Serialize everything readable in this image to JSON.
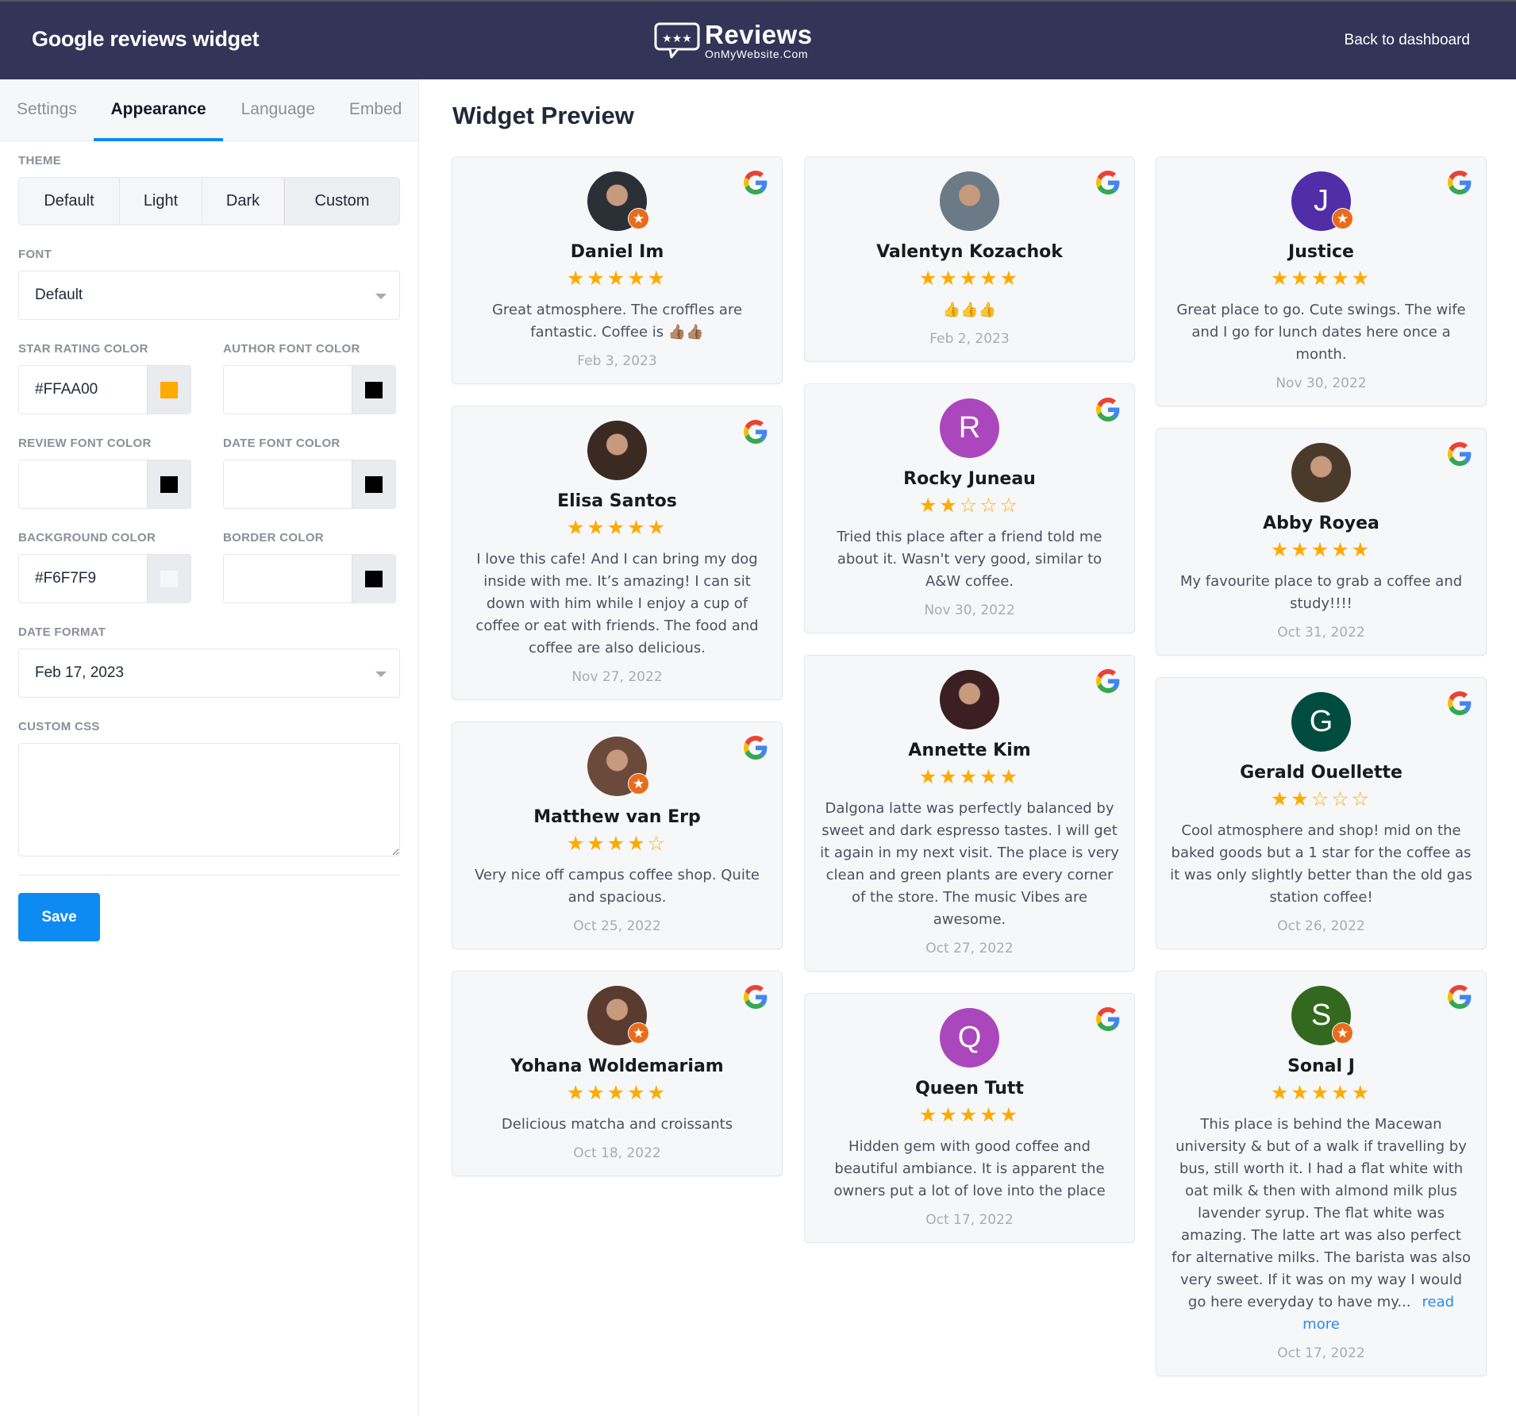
{
  "header": {
    "title": "Google reviews widget",
    "logo_big": "Reviews",
    "logo_small": "OnMyWebsite.Com",
    "back_link": "Back to dashboard"
  },
  "tabs": [
    {
      "label": "Settings",
      "active": false
    },
    {
      "label": "Appearance",
      "active": true
    },
    {
      "label": "Language",
      "active": false
    },
    {
      "label": "Embed",
      "active": false
    }
  ],
  "form": {
    "theme_label": "THEME",
    "theme_options": [
      "Default",
      "Light",
      "Dark",
      "Custom"
    ],
    "theme_selected": "Custom",
    "font_label": "FONT",
    "font_value": "Default",
    "star_color_label": "STAR RATING COLOR",
    "star_color_value": "#FFAA00",
    "star_color_swatch": "#FFAA00",
    "author_color_label": "AUTHOR FONT COLOR",
    "author_color_value": "",
    "author_color_swatch": "#000000",
    "review_color_label": "REVIEW FONT COLOR",
    "review_color_value": "",
    "review_color_swatch": "#000000",
    "date_color_label": "DATE FONT COLOR",
    "date_color_value": "",
    "date_color_swatch": "#000000",
    "bg_color_label": "BACKGROUND COLOR",
    "bg_color_value": "#F6F7F9",
    "bg_color_swatch": "#F6F7F9",
    "border_color_label": "BORDER COLOR",
    "border_color_value": "",
    "border_color_swatch": "#000000",
    "date_format_label": "DATE FORMAT",
    "date_format_value": "Feb 17, 2023",
    "custom_css_label": "CUSTOM CSS",
    "custom_css_value": "",
    "save_label": "Save"
  },
  "preview": {
    "title": "Widget Preview",
    "star_full": "★",
    "star_empty": "☆",
    "badge_icon": "★",
    "read_more": "read more",
    "columns": [
      [
        {
          "author": "Daniel Im",
          "rating": 5,
          "text": "Great atmosphere. The croffles are fantastic. Coffee is 👍🏽👍🏽",
          "date": "Feb 3, 2023",
          "avatar": {
            "type": "photo",
            "color": "#2b2f36"
          },
          "local_guide": true
        },
        {
          "author": "Elisa Santos",
          "rating": 5,
          "text": "I love this cafe! And I can bring my dog inside with me. It’s amazing! I can sit down with him while I enjoy a cup of coffee or eat with friends. The food and coffee are also delicious.",
          "date": "Nov 27, 2022",
          "avatar": {
            "type": "photo",
            "color": "#3a2a22"
          },
          "local_guide": false
        },
        {
          "author": "Matthew van Erp",
          "rating": 4,
          "text": "Very nice off campus coffee shop. Quite and spacious.",
          "date": "Oct 25, 2022",
          "avatar": {
            "type": "photo",
            "color": "#6b4a3c"
          },
          "local_guide": true
        },
        {
          "author": "Yohana Woldemariam",
          "rating": 5,
          "text": "Delicious matcha and croissants",
          "date": "Oct 18, 2022",
          "avatar": {
            "type": "photo",
            "color": "#5a3b30"
          },
          "local_guide": true
        }
      ],
      [
        {
          "author": "Valentyn Kozachok",
          "rating": 5,
          "text": "👍👍👍",
          "date": "Feb 2, 2023",
          "avatar": {
            "type": "photo",
            "color": "#6a7a86"
          },
          "local_guide": false
        },
        {
          "author": "Rocky Juneau",
          "rating": 2,
          "text": "Tried this place after a friend told me about it. Wasn't very good, similar to A&W coffee.",
          "date": "Nov 30, 2022",
          "avatar": {
            "type": "initial",
            "initial": "R",
            "color": "#ab47bc"
          },
          "local_guide": false
        },
        {
          "author": "Annette Kim",
          "rating": 5,
          "text": "Dalgona latte was perfectly balanced by sweet and dark espresso tastes. I will get it again in my next visit. The place is very clean and green plants are every corner of the store. The music Vibes are awesome.",
          "date": "Oct 27, 2022",
          "avatar": {
            "type": "photo",
            "color": "#3b1f22"
          },
          "local_guide": false
        },
        {
          "author": "Queen Tutt",
          "rating": 5,
          "text": "Hidden gem with good coffee and beautiful ambiance. It is apparent the owners put a lot of love into the place",
          "date": "Oct 17, 2022",
          "avatar": {
            "type": "initial",
            "initial": "Q",
            "color": "#ab47bc"
          },
          "local_guide": false
        }
      ],
      [
        {
          "author": "Justice",
          "rating": 5,
          "text": "Great place to go. Cute swings. The wife and I go for lunch dates here once a month.",
          "date": "Nov 30, 2022",
          "avatar": {
            "type": "initial",
            "initial": "J",
            "color": "#512da8"
          },
          "local_guide": true
        },
        {
          "author": "Abby Royea",
          "rating": 5,
          "text": "My favourite place to grab a coffee and study!!!!",
          "date": "Oct 31, 2022",
          "avatar": {
            "type": "photo",
            "color": "#4a3a2a"
          },
          "local_guide": false
        },
        {
          "author": "Gerald Ouellette",
          "rating": 2,
          "text": "Cool atmosphere and shop! mid on the baked goods but a 1 star for the coffee as it was only slightly better than the old gas station coffee!",
          "date": "Oct 26, 2022",
          "avatar": {
            "type": "initial",
            "initial": "G",
            "color": "#004d40"
          },
          "local_guide": false
        },
        {
          "author": "Sonal J",
          "rating": 5,
          "text": "This place is behind the Macewan university & but of a walk if travelling by bus, still worth it. I had a flat white with oat milk & then with almond milk plus lavender syrup. The flat white was amazing. The latte art was also perfect for alternative milks. The barista was also very sweet. If it was on my way I would go here everyday to have my...",
          "date": "Oct 17, 2022",
          "avatar": {
            "type": "initial",
            "initial": "S",
            "color": "#33691e"
          },
          "local_guide": true,
          "truncated": true
        }
      ]
    ]
  }
}
